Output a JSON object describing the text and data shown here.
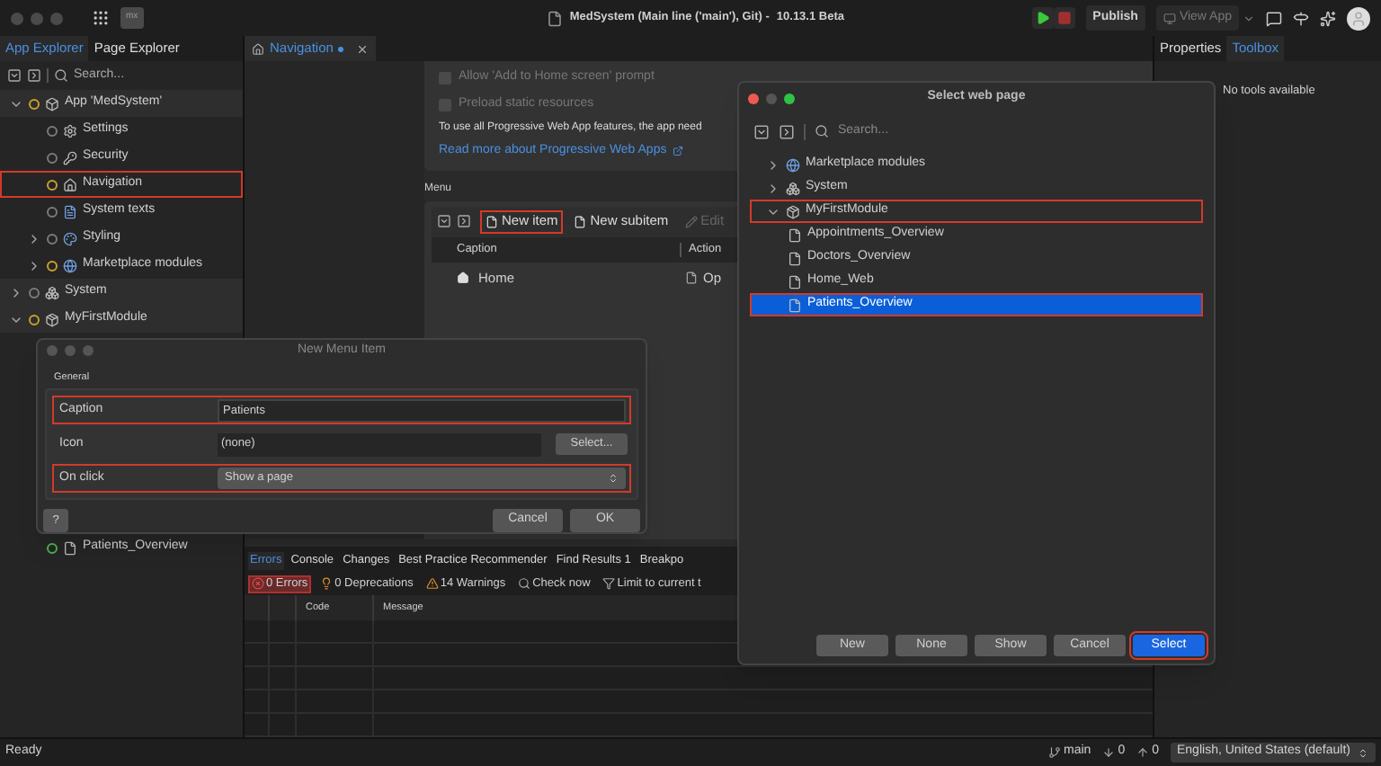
{
  "title_bar": {
    "app_badge": "mx",
    "title": "MedSystem (Main line ('main'), Git) -",
    "version": "10.13.1 Beta",
    "publish": "Publish",
    "view_app": "View App"
  },
  "app_explorer": {
    "tabs": [
      {
        "label": "App Explorer",
        "selected": true
      },
      {
        "label": "Page Explorer",
        "selected": false
      }
    ],
    "search_placeholder": "Search...",
    "tree": [
      {
        "kind": "app",
        "label": "App 'MedSystem'",
        "color": "#c8a030",
        "expanded": true,
        "highlighted": false,
        "children": [
          {
            "kind": "settings",
            "label": "Settings",
            "color": "#7a7a7a",
            "highlighted": false
          },
          {
            "kind": "security",
            "label": "Security",
            "color": "#7a7a7a",
            "highlighted": false
          },
          {
            "kind": "navigation",
            "label": "Navigation",
            "color": "#c8a030",
            "highlighted": true
          },
          {
            "kind": "texts",
            "label": "System texts",
            "color": "#7a7a7a",
            "highlighted": false
          },
          {
            "kind": "styling",
            "label": "Styling",
            "color": "#7a7a7a",
            "expanded": false,
            "highlighted": false
          },
          {
            "kind": "marketplace",
            "label": "Marketplace modules",
            "color": "#c8a030",
            "expanded": false,
            "highlighted": false
          }
        ]
      },
      {
        "kind": "system",
        "label": "System",
        "color": "#7a7a7a",
        "expanded": false,
        "highlighted": false
      },
      {
        "kind": "module",
        "label": "MyFirstModule",
        "color": "#c8a030",
        "expanded": true,
        "highlighted": false,
        "children": [
          {
            "kind": "page",
            "label": "Patients_Overview",
            "color": "#4caf50",
            "highlighted": false
          }
        ]
      }
    ]
  },
  "editor": {
    "tab": {
      "label": "Navigation",
      "modified": true
    },
    "pwa_options": [
      {
        "label": "Allow 'Add to Home screen' prompt",
        "checked": false,
        "disabled": true
      },
      {
        "label": "Preload static resources",
        "checked": false,
        "disabled": true
      }
    ],
    "pwa_note": "To use all Progressive Web App features, the app need",
    "pwa_link": "Read more about Progressive Web Apps",
    "menu": {
      "title": "Menu",
      "toolbar": [
        {
          "kind": "new",
          "label": "New item",
          "disabled": false,
          "highlighted": true
        },
        {
          "kind": "new",
          "label": "New subitem",
          "disabled": false,
          "highlighted": false
        },
        {
          "kind": "edit",
          "label": "Edit",
          "disabled": true,
          "highlighted": false
        }
      ],
      "columns": [
        "Caption",
        "Action"
      ],
      "rows": [
        {
          "caption": "Home",
          "action": "Op"
        }
      ]
    }
  },
  "bottom_panel": {
    "tabs": [
      {
        "label": "Errors",
        "selected": true
      },
      {
        "label": "Console",
        "selected": false
      },
      {
        "label": "Changes",
        "selected": false
      },
      {
        "label": "Best Practice Recommender",
        "selected": false
      },
      {
        "label": "Find Results 1",
        "selected": false
      },
      {
        "label": "Breakpo",
        "selected": false
      }
    ],
    "filters": [
      {
        "kind": "errors",
        "label": "0 Errors",
        "selected": true
      },
      {
        "kind": "deprecations",
        "label": "0 Deprecations",
        "selected": false
      },
      {
        "kind": "warnings",
        "label": "14 Warnings",
        "selected": false
      },
      {
        "kind": "check",
        "label": "Check now",
        "selected": false
      },
      {
        "kind": "limit",
        "label": "Limit to current t",
        "selected": false
      }
    ],
    "columns": [
      "Code",
      "Message"
    ]
  },
  "properties_panel": {
    "tabs": [
      {
        "label": "Properties",
        "selected": false
      },
      {
        "label": "Toolbox",
        "selected": true
      }
    ],
    "message": "No tools available"
  },
  "status_bar": {
    "text": "Ready",
    "branch": "main",
    "incoming": "0",
    "outgoing": "0",
    "language": "English, United States (default)"
  },
  "new_menu_item_dialog": {
    "title": "New Menu Item",
    "section": "General",
    "fields": [
      {
        "kind": "text",
        "label": "Caption",
        "value": "Patients",
        "highlighted": true
      },
      {
        "kind": "picker",
        "label": "Icon",
        "value": "(none)",
        "button": "Select...",
        "highlighted": false
      },
      {
        "kind": "select",
        "label": "On click",
        "value": "Show a page",
        "highlighted": true
      }
    ],
    "help": "?",
    "buttons": [
      "Cancel",
      "OK"
    ]
  },
  "select_page_dialog": {
    "title": "Select web page",
    "search_placeholder": "Search...",
    "tree": [
      {
        "kind": "marketplace",
        "label": "Marketplace modules",
        "expanded": false,
        "highlighted": false,
        "selected": false
      },
      {
        "kind": "system",
        "label": "System",
        "expanded": false,
        "highlighted": false,
        "selected": false
      },
      {
        "kind": "module",
        "label": "MyFirstModule",
        "expanded": true,
        "highlighted": true,
        "selected": false,
        "children": [
          {
            "kind": "page",
            "label": "Appointments_Overview",
            "highlighted": false,
            "selected": false
          },
          {
            "kind": "page",
            "label": "Doctors_Overview",
            "highlighted": false,
            "selected": false
          },
          {
            "kind": "page",
            "label": "Home_Web",
            "highlighted": false,
            "selected": false
          },
          {
            "kind": "page",
            "label": "Patients_Overview",
            "highlighted": true,
            "selected": true
          }
        ]
      }
    ],
    "buttons": [
      {
        "label": "New",
        "primary": false,
        "highlighted": false
      },
      {
        "label": "None",
        "primary": false,
        "highlighted": false
      },
      {
        "label": "Show",
        "primary": false,
        "highlighted": false
      },
      {
        "label": "Cancel",
        "primary": false,
        "highlighted": false
      },
      {
        "label": "Select",
        "primary": true,
        "highlighted": true
      }
    ]
  }
}
